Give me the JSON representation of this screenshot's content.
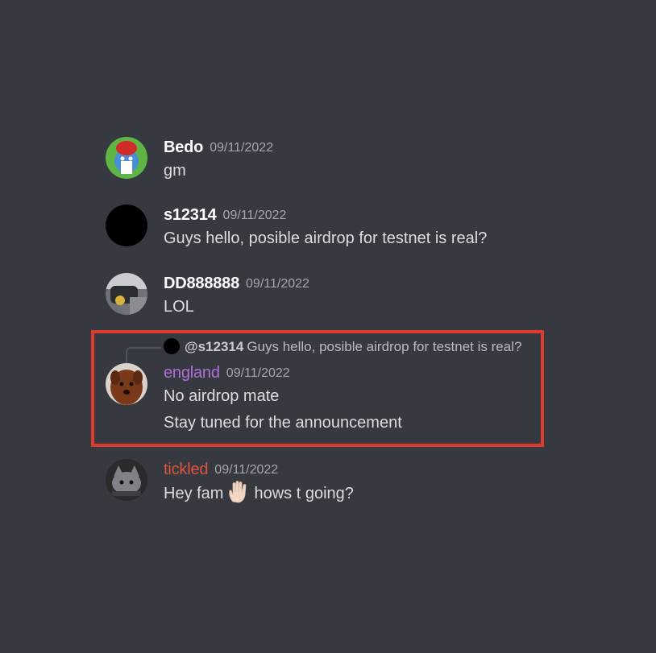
{
  "messages": [
    {
      "username": "Bedo",
      "username_color": "#ffffff",
      "timestamp": "09/11/2022",
      "lines": [
        "gm"
      ],
      "avatar_icon": "smurf-avatar-icon"
    },
    {
      "username": "s12314",
      "username_color": "#ffffff",
      "timestamp": "09/11/2022",
      "lines": [
        "Guys hello, posible airdrop for testnet is real?"
      ],
      "avatar_icon": "black-circle-avatar-icon"
    },
    {
      "username": "DD888888",
      "username_color": "#ffffff",
      "timestamp": "09/11/2022",
      "lines": [
        "LOL"
      ],
      "avatar_icon": "photo-avatar-icon"
    },
    {
      "reply_to": {
        "mention": "@s12314",
        "text": "Guys hello, posible airdrop for testnet is real?"
      },
      "username": "england",
      "username_color": "#b06fd8",
      "timestamp": "09/11/2022",
      "lines": [
        "No airdrop mate",
        "Stay tuned for the announcement"
      ],
      "avatar_icon": "dog-avatar-icon"
    },
    {
      "username": "tickled",
      "username_color": "#e0533f",
      "timestamp": "09/11/2022",
      "lines_parts": [
        "Hey fam",
        "hows t going?"
      ],
      "emoji": "raised-hand-icon",
      "avatar_icon": "cat-avatar-icon"
    }
  ],
  "colors": {
    "background": "#36393f",
    "highlight_border": "#e03a2f"
  }
}
